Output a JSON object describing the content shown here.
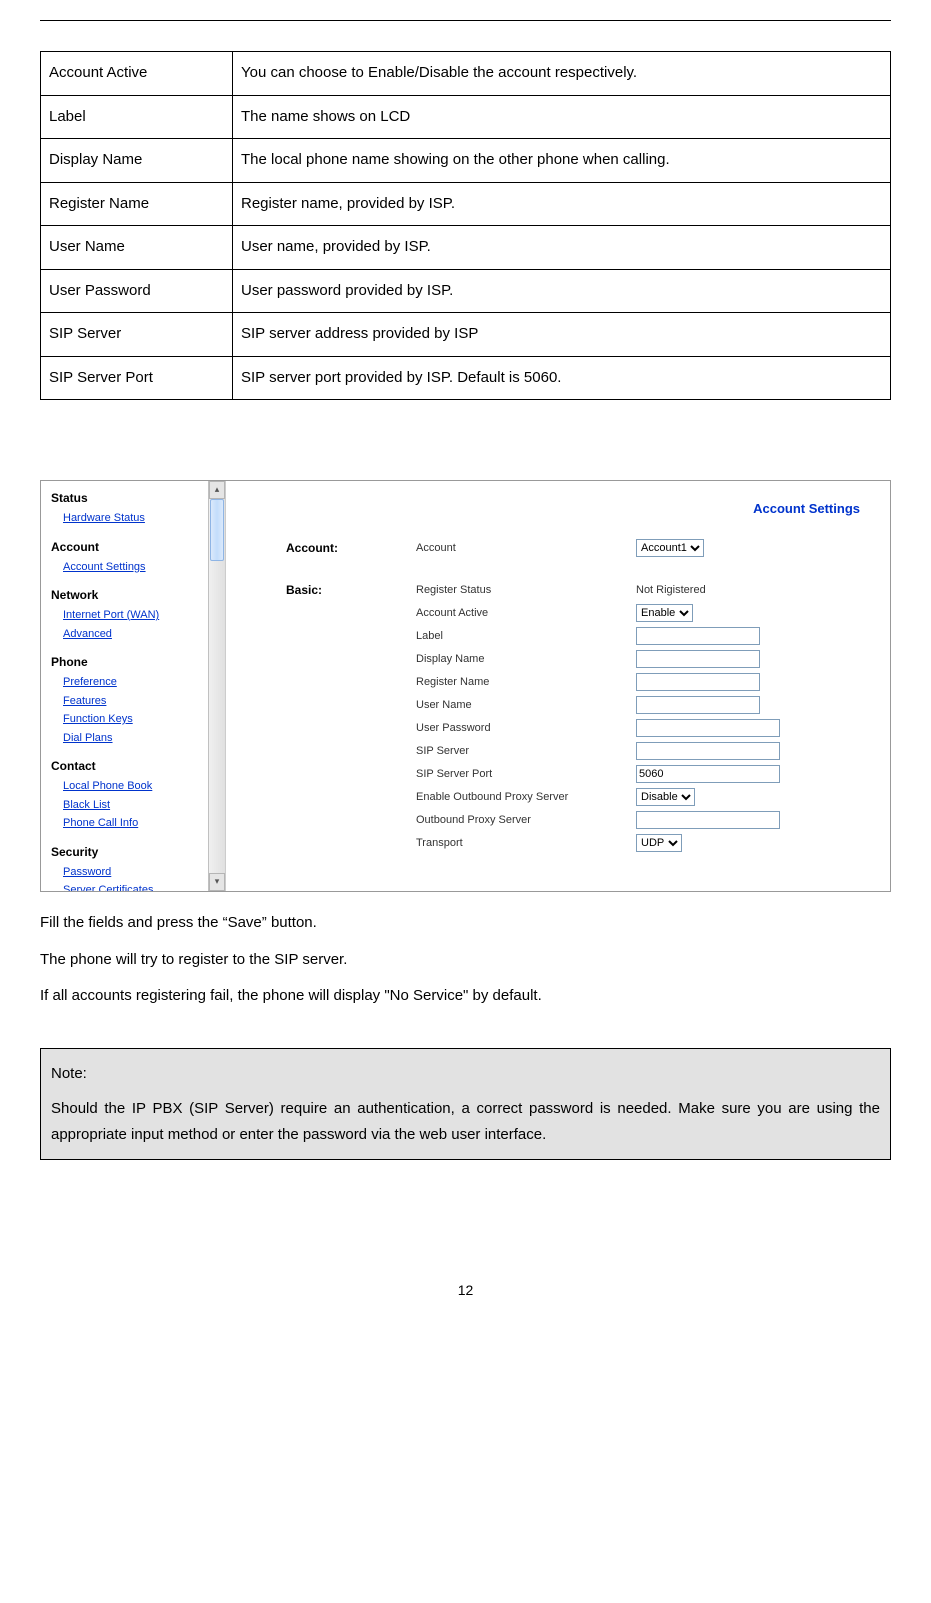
{
  "table": {
    "rows": [
      {
        "term": "Account Active",
        "desc": "You can choose to Enable/Disable the account respectively."
      },
      {
        "term": "Label",
        "desc": "The name shows on LCD"
      },
      {
        "term": "Display Name",
        "desc": "The local phone name showing on the other phone when calling."
      },
      {
        "term": "Register Name",
        "desc": "Register name, provided by ISP."
      },
      {
        "term": "User Name",
        "desc": "User name, provided by ISP."
      },
      {
        "term": "User Password",
        "desc": "User password provided by ISP."
      },
      {
        "term": "SIP Server",
        "desc": "SIP server address provided by ISP"
      },
      {
        "term": "SIP Server Port",
        "desc": "SIP server port provided by ISP. Default is 5060."
      }
    ]
  },
  "screenshot": {
    "title": "Account Settings",
    "sections": {
      "account_label": "Account:",
      "basic_label": "Basic:"
    },
    "sidebar": {
      "groups": [
        {
          "title": "Status",
          "links": [
            "Hardware Status"
          ]
        },
        {
          "title": "Account",
          "links": [
            "Account Settings"
          ]
        },
        {
          "title": "Network",
          "links": [
            "Internet Port (WAN)",
            "Advanced"
          ]
        },
        {
          "title": "Phone",
          "links": [
            "Preference",
            "Features",
            "Function Keys",
            "Dial Plans"
          ]
        },
        {
          "title": "Contact",
          "links": [
            "Local Phone Book",
            "Black List",
            "Phone Call Info"
          ]
        },
        {
          "title": "Security",
          "links": [
            "Password",
            "Server Certificates"
          ]
        }
      ]
    },
    "fields": {
      "account": {
        "label": "Account",
        "value": "Account1"
      },
      "register_status": {
        "label": "Register Status",
        "value": "Not Rigistered"
      },
      "account_active": {
        "label": "Account Active",
        "value": "Enable"
      },
      "label_f": {
        "label": "Label",
        "value": ""
      },
      "display_name": {
        "label": "Display Name",
        "value": ""
      },
      "register_name": {
        "label": "Register Name",
        "value": ""
      },
      "user_name": {
        "label": "User Name",
        "value": ""
      },
      "user_password": {
        "label": "User Password",
        "value": ""
      },
      "sip_server": {
        "label": "SIP Server",
        "value": ""
      },
      "sip_server_port": {
        "label": "SIP Server Port",
        "value": "5060"
      },
      "outbound_proxy_enable": {
        "label": "Enable Outbound Proxy Server",
        "value": "Disable"
      },
      "outbound_proxy_server": {
        "label": "Outbound Proxy Server",
        "value": ""
      },
      "transport": {
        "label": "Transport",
        "value": "UDP"
      }
    }
  },
  "body_text": {
    "p1": "Fill the fields and press the “Save” button.",
    "p2": "The phone will try to register to the SIP server.",
    "p3": "If all accounts registering fail, the phone will display \"No Service\" by default."
  },
  "note": {
    "title": "Note:",
    "body": "Should the IP PBX (SIP Server) require an authentication, a correct password is needed. Make sure you are using the appropriate input method or enter the password via the web user interface."
  },
  "page_number": "12"
}
